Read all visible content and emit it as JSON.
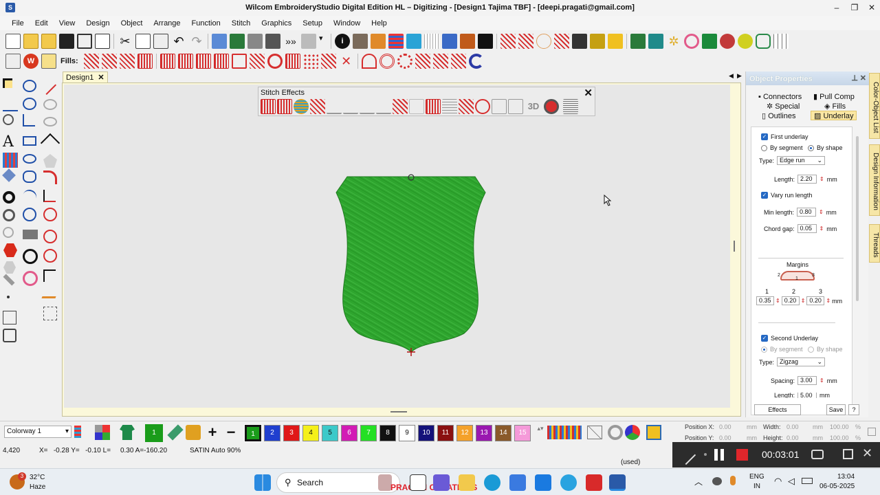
{
  "window": {
    "title": "Wilcom EmbroideryStudio Digital Edition HL – Digitizing - [Design1        Tajima TBF] - [deepi.pragati@gmail.com]"
  },
  "menu": [
    "File",
    "Edit",
    "View",
    "Design",
    "Object",
    "Arrange",
    "Function",
    "Stitch",
    "Graphics",
    "Setup",
    "Window",
    "Help"
  ],
  "fills_toolbar": {
    "label": "Fills:"
  },
  "doc_tab": {
    "label": "Design1",
    "close": "✕"
  },
  "stitch_effects": {
    "title": "Stitch Effects",
    "close": "✕",
    "label_3d": "3D"
  },
  "object_properties": {
    "title": "Object Properties",
    "tabs": {
      "connectors": "Connectors",
      "pull_comp": "Pull Comp",
      "special": "Special",
      "fills": "Fills",
      "outlines": "Outlines",
      "underlay": "Underlay"
    },
    "first_underlay": {
      "label": "First underlay",
      "by_segment": "By segment",
      "by_shape": "By shape",
      "type_label": "Type:",
      "type_value": "Edge run",
      "length_label": "Length:",
      "length_value": "2.20",
      "unit": "mm",
      "vary_label": "Vary run length",
      "min_length_label": "Min length:",
      "min_length_value": "0.80",
      "chord_gap_label": "Chord gap:",
      "chord_gap_value": "0.05"
    },
    "margins": {
      "label": "Margins",
      "c1": "1",
      "c2": "2",
      "c3": "3",
      "v1": "0.35",
      "v2": "0.20",
      "v3": "0.20",
      "unit": "mm",
      "diag_left": "2",
      "diag_mid": "1",
      "diag_right": "3"
    },
    "second_underlay": {
      "label": "Second Underlay",
      "by_segment": "By segment",
      "by_shape": "By shape",
      "type_label": "Type:",
      "type_value": "Zigzag",
      "spacing_label": "Spacing:",
      "spacing_value": "3.00",
      "length_label": "Length:",
      "length_value": "5.00",
      "unit": "mm"
    },
    "effects_button": "Effects",
    "save_button": "Save",
    "help_button": "?"
  },
  "side_tabs": {
    "color_list": "Color-Object List",
    "design_info": "Design Information",
    "threads": "Threads"
  },
  "colorway": {
    "value": "Colorway 1",
    "active_swatch": "1"
  },
  "swatches": [
    {
      "n": "1",
      "c": "#1a9c1a"
    },
    {
      "n": "2",
      "c": "#1f3fcf"
    },
    {
      "n": "3",
      "c": "#e01818"
    },
    {
      "n": "4",
      "c": "#f5f01a"
    },
    {
      "n": "5",
      "c": "#3cc9c9"
    },
    {
      "n": "6",
      "c": "#d21bb5"
    },
    {
      "n": "7",
      "c": "#24e024"
    },
    {
      "n": "8",
      "c": "#111111"
    },
    {
      "n": "9",
      "c": "#ffffff"
    },
    {
      "n": "10",
      "c": "#14127a"
    },
    {
      "n": "11",
      "c": "#8a1010"
    },
    {
      "n": "12",
      "c": "#f4a12a"
    },
    {
      "n": "13",
      "c": "#9a18b0"
    },
    {
      "n": "14",
      "c": "#8a5a2a"
    },
    {
      "n": "15",
      "c": "#f59ad9"
    }
  ],
  "position_panel": {
    "pos_x_label": "Position X:",
    "pos_x": "0.00",
    "pos_y_label": "Position Y:",
    "pos_y": "0.00",
    "unit": "mm",
    "width_label": "Width:",
    "width": "0.00",
    "height_label": "Height:",
    "height": "0.00",
    "pct": "100.00",
    "pct_unit": "%"
  },
  "status": {
    "coords": "4,420",
    "xy": "X=   -0.28 Y=   -0.10 L=     0.30 A=-160.20",
    "stitch": "SATIN Auto 90%",
    "used": "(used)"
  },
  "recorder": {
    "time": "00:03:01"
  },
  "taskbar": {
    "temp": "32°C",
    "weather": "Haze",
    "badge": "3",
    "search": "Search",
    "watermark": "PRAGATI CREATIONS",
    "lang1": "ENG",
    "lang2": "IN",
    "time": "13:04",
    "date": "06-05-2025"
  }
}
